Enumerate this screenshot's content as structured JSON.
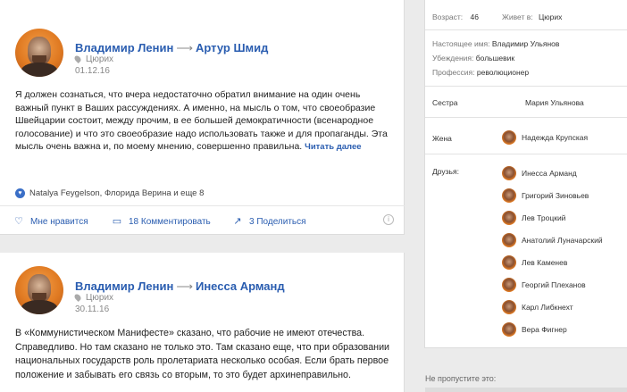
{
  "posts": [
    {
      "author": "Владимир Ленин",
      "recipient": "Артур Шмид",
      "location": "Цюрих",
      "date": "01.12.16",
      "text": "Я должен сознаться, что вчера недостаточно обратил внимание на один очень важный пункт в Ваших рассуждениях. А именно, на мысль о том, что своеобразие Швейцарии состоит, между прочим, в ее большей демократичности (всенародное голосование) и что это своеобразие надо использовать также и для пропаганды. Эта мысль очень важна и, по моему мнению, совершенно правильна.",
      "read_more": "Читать далее",
      "likers": "Natalya Feygelson, Флорида Верина и еще 8",
      "like_label": "Мне нравится",
      "comment_label": "18 Комментировать",
      "share_label": "3 Поделиться"
    },
    {
      "author": "Владимир Ленин",
      "recipient": "Инесса Арманд",
      "location": "Цюрих",
      "date": "30.11.16",
      "text": "В «Коммунистическом Манифесте» сказано, что рабочие не имеют отечества. Справедливо. Но там сказано не только это. Там сказано еще, что при образовании национальных государств роль пролетариата несколько особая. Если брать первое положение и забывать его связь со вторым, то это будет архинеправильно."
    }
  ],
  "profile": {
    "age_label": "Возраст:",
    "age": "46",
    "lives_label": "Живет в:",
    "lives": "Цюрих",
    "real_name_label": "Настоящее имя:",
    "real_name": "Владимир Ульянов",
    "beliefs_label": "Убеждения:",
    "beliefs": "большевик",
    "profession_label": "Профессия:",
    "profession": "революционер",
    "sister_label": "Сестра",
    "sister": "Мария Ульянова",
    "wife_label": "Жена",
    "wife": "Надежда Крупская",
    "friends_label": "Друзья:",
    "friends": [
      "Инесса Арманд",
      "Григорий Зиновьев",
      "Лев Троцкий",
      "Анатолий Луначарский",
      "Лев Каменев",
      "Георгий Плеханов",
      "Карл Либкнехт",
      "Вера Фигнер"
    ]
  },
  "dont_miss": "Не пропустите это:",
  "icons": {
    "location": "pin-icon",
    "like": "heart-icon",
    "comment": "comment-icon",
    "share": "share-icon",
    "info": "info-icon"
  },
  "colors": {
    "link": "#2a5db0",
    "avatar": "#e07a22"
  }
}
